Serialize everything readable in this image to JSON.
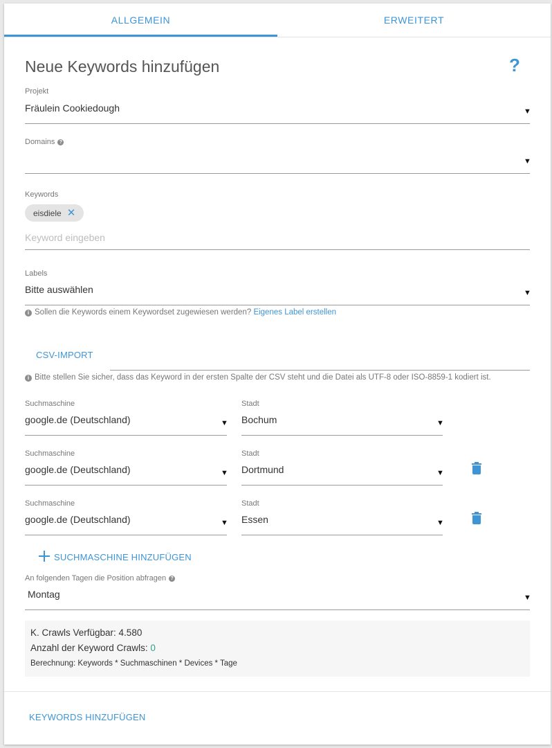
{
  "tabs": [
    {
      "label": "ALLGEMEIN",
      "active": true
    },
    {
      "label": "ERWEITERT",
      "active": false
    }
  ],
  "header": {
    "title": "Neue Keywords hinzufügen",
    "help": "?"
  },
  "projekt": {
    "label": "Projekt",
    "value": "Fräulein Cookiedough"
  },
  "domains": {
    "label": "Domains",
    "value": ""
  },
  "keywords": {
    "label": "Keywords",
    "chips": [
      "eisdiele"
    ],
    "placeholder": "Keyword eingeben"
  },
  "labels": {
    "label": "Labels",
    "value": "Bitte auswählen",
    "hint": "Sollen die Keywords einem Keywordset zugewiesen werden?",
    "hint_link": "Eigenes Label erstellen"
  },
  "csv": {
    "button": "CSV-IMPORT",
    "hint": "Bitte stellen Sie sicher, dass das Keyword in der ersten Spalte der CSV steht und die Datei als UTF-8 oder ISO-8859-1 kodiert ist."
  },
  "engines": [
    {
      "engine_label": "Suchmaschine",
      "engine": "google.de (Deutschland)",
      "city_label": "Stadt",
      "city": "Bochum",
      "deletable": false
    },
    {
      "engine_label": "Suchmaschine",
      "engine": "google.de (Deutschland)",
      "city_label": "Stadt",
      "city": "Dortmund",
      "deletable": true
    },
    {
      "engine_label": "Suchmaschine",
      "engine": "google.de (Deutschland)",
      "city_label": "Stadt",
      "city": "Essen",
      "deletable": true
    }
  ],
  "add_engine": "SUCHMASCHINE HINZUFÜGEN",
  "days": {
    "label": "An folgenden Tagen die Position abfragen",
    "value": "Montag"
  },
  "info": {
    "crawls_available": "K. Crawls Verfügbar: 4.580",
    "keyword_crawls_label": "Anzahl der Keyword Crawls: ",
    "keyword_crawls_value": "0",
    "formula": "Berechnung: Keywords * Suchmaschinen * Devices * Tage"
  },
  "footer": {
    "submit": "KEYWORDS HINZUFÜGEN"
  },
  "icons": {
    "dropdown": "caret-down-icon",
    "delete": "trash-icon",
    "add": "plus-icon",
    "info": "info-icon",
    "help": "help-icon"
  },
  "colors": {
    "accent": "#3d95d6",
    "positive": "#2ba58a"
  }
}
